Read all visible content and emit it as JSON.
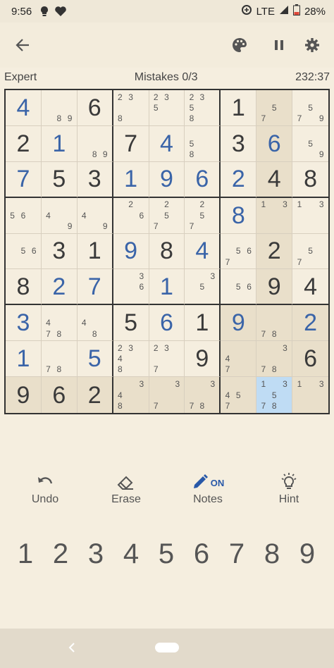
{
  "status": {
    "time": "9:56",
    "network": "LTE",
    "battery": "28%"
  },
  "appbar": {
    "back_icon": "arrow-left-icon",
    "theme_icon": "palette-icon",
    "pause_icon": "pause-icon",
    "settings_icon": "gear-icon"
  },
  "info": {
    "difficulty": "Expert",
    "mistakes": "Mistakes 0/3",
    "timer": "232:37"
  },
  "colors": {
    "accent": "#3a64a8",
    "given": "#3a3a3a",
    "selected": "#bfdcf4",
    "highlight": "#e9dfca",
    "background": "#f5eedf"
  },
  "selected_cell": {
    "row": 9,
    "col": 8
  },
  "grid": [
    [
      {
        "v": "4",
        "t": "user"
      },
      {
        "n": [
          "",
          "",
          "",
          "",
          "",
          "",
          "",
          "8",
          "9"
        ]
      },
      {
        "v": "6",
        "t": "given"
      },
      {
        "n": [
          "2",
          "3",
          "",
          "",
          "",
          "",
          "8",
          "",
          ""
        ]
      },
      {
        "n": [
          "2",
          "3",
          "",
          "5",
          "",
          "",
          "",
          "",
          ""
        ]
      },
      {
        "n": [
          "2",
          "3",
          "",
          "5",
          "",
          "",
          "8",
          "",
          ""
        ]
      },
      {
        "v": "1",
        "t": "given"
      },
      {
        "n": [
          "",
          "",
          "",
          "",
          "5",
          "",
          "7",
          "",
          ""
        ]
      },
      {
        "n": [
          "",
          "",
          "",
          "",
          "5",
          "",
          "7",
          "",
          "9"
        ]
      }
    ],
    [
      {
        "v": "2",
        "t": "given"
      },
      {
        "v": "1",
        "t": "user"
      },
      {
        "n": [
          "",
          "",
          "",
          "",
          "",
          "",
          "",
          "8",
          "9"
        ]
      },
      {
        "v": "7",
        "t": "given"
      },
      {
        "v": "4",
        "t": "user"
      },
      {
        "n": [
          "",
          "",
          "",
          "5",
          "",
          "",
          "8",
          "",
          ""
        ]
      },
      {
        "v": "3",
        "t": "given"
      },
      {
        "v": "6",
        "t": "user"
      },
      {
        "n": [
          "",
          "",
          "",
          "",
          "5",
          "",
          "",
          "",
          "9"
        ]
      }
    ],
    [
      {
        "v": "7",
        "t": "user"
      },
      {
        "v": "5",
        "t": "given"
      },
      {
        "v": "3",
        "t": "given"
      },
      {
        "v": "1",
        "t": "user"
      },
      {
        "v": "9",
        "t": "user"
      },
      {
        "v": "6",
        "t": "user"
      },
      {
        "v": "2",
        "t": "user"
      },
      {
        "v": "4",
        "t": "given"
      },
      {
        "v": "8",
        "t": "given"
      }
    ],
    [
      {
        "n": [
          "",
          "",
          "",
          "5",
          "6",
          "",
          "",
          "",
          ""
        ]
      },
      {
        "n": [
          "",
          "",
          "",
          "4",
          "",
          "",
          "",
          "",
          "9"
        ]
      },
      {
        "n": [
          "",
          "",
          "",
          "4",
          "",
          "",
          "",
          "",
          "9"
        ]
      },
      {
        "n": [
          "",
          "2",
          "",
          "",
          "",
          "6",
          "",
          "",
          ""
        ]
      },
      {
        "n": [
          "",
          "2",
          "",
          "",
          "5",
          "",
          "7",
          "",
          ""
        ]
      },
      {
        "n": [
          "",
          "2",
          "",
          "",
          "5",
          "",
          "7",
          "",
          ""
        ]
      },
      {
        "v": "8",
        "t": "user"
      },
      {
        "n": [
          "1",
          "",
          "3",
          "",
          "",
          "",
          "",
          "",
          ""
        ]
      },
      {
        "n": [
          "1",
          "",
          "3",
          "",
          "",
          "",
          "",
          "",
          ""
        ]
      }
    ],
    [
      {
        "n": [
          "",
          "",
          "",
          "",
          "5",
          "6",
          "",
          "",
          ""
        ]
      },
      {
        "v": "3",
        "t": "given"
      },
      {
        "v": "1",
        "t": "given"
      },
      {
        "v": "9",
        "t": "user"
      },
      {
        "v": "8",
        "t": "given"
      },
      {
        "v": "4",
        "t": "user"
      },
      {
        "n": [
          "",
          "",
          "",
          "",
          "5",
          "6",
          "7",
          "",
          ""
        ]
      },
      {
        "v": "2",
        "t": "given"
      },
      {
        "n": [
          "",
          "",
          "",
          "",
          "5",
          "",
          "7",
          "",
          ""
        ]
      }
    ],
    [
      {
        "v": "8",
        "t": "given"
      },
      {
        "v": "2",
        "t": "user"
      },
      {
        "v": "7",
        "t": "user"
      },
      {
        "n": [
          "",
          "",
          "3",
          "",
          "",
          "6",
          "",
          "",
          ""
        ]
      },
      {
        "v": "1",
        "t": "user"
      },
      {
        "n": [
          "",
          "",
          "3",
          "",
          "5",
          "",
          "",
          "",
          ""
        ]
      },
      {
        "n": [
          "",
          "",
          "",
          "",
          "5",
          "6",
          "",
          "",
          ""
        ]
      },
      {
        "v": "9",
        "t": "given"
      },
      {
        "v": "4",
        "t": "given"
      }
    ],
    [
      {
        "v": "3",
        "t": "user"
      },
      {
        "n": [
          "",
          "",
          "",
          "4",
          "",
          "",
          "7",
          "8",
          ""
        ]
      },
      {
        "n": [
          "",
          "",
          "",
          "4",
          "",
          "",
          "",
          "8",
          ""
        ]
      },
      {
        "v": "5",
        "t": "given"
      },
      {
        "v": "6",
        "t": "user"
      },
      {
        "v": "1",
        "t": "given"
      },
      {
        "v": "9",
        "t": "user"
      },
      {
        "n": [
          "",
          "",
          "",
          "",
          "",
          "",
          "7",
          "8",
          ""
        ]
      },
      {
        "v": "2",
        "t": "user"
      }
    ],
    [
      {
        "v": "1",
        "t": "user"
      },
      {
        "n": [
          "",
          "",
          "",
          "",
          "",
          "",
          "7",
          "8",
          ""
        ]
      },
      {
        "v": "5",
        "t": "user"
      },
      {
        "n": [
          "2",
          "3",
          "",
          "4",
          "",
          "",
          "8",
          "",
          ""
        ]
      },
      {
        "n": [
          "2",
          "3",
          "",
          "",
          "",
          "",
          "7",
          "",
          ""
        ]
      },
      {
        "v": "9",
        "t": "given"
      },
      {
        "n": [
          "",
          "",
          "",
          "4",
          "",
          "",
          "7",
          "",
          ""
        ]
      },
      {
        "n": [
          "",
          "",
          "3",
          "",
          "",
          "",
          "7",
          "8",
          ""
        ]
      },
      {
        "v": "6",
        "t": "given"
      }
    ],
    [
      {
        "v": "9",
        "t": "given"
      },
      {
        "v": "6",
        "t": "given"
      },
      {
        "v": "2",
        "t": "given"
      },
      {
        "n": [
          "",
          "",
          "3",
          "4",
          "",
          "",
          "8",
          "",
          ""
        ]
      },
      {
        "n": [
          "",
          "",
          "3",
          "",
          "",
          "",
          "7",
          "",
          ""
        ]
      },
      {
        "n": [
          "",
          "",
          "3",
          "",
          "",
          "",
          "7",
          "8",
          ""
        ]
      },
      {
        "n": [
          "",
          "",
          "",
          "4",
          "5",
          "",
          "7",
          "",
          ""
        ]
      },
      {
        "n": [
          "1",
          "",
          "3",
          "",
          "5",
          "",
          "7",
          "8",
          ""
        ]
      },
      {
        "n": [
          "1",
          "",
          "3",
          "",
          "",
          "",
          "",
          "",
          ""
        ]
      }
    ]
  ],
  "tools": [
    {
      "name": "undo",
      "label": "Undo",
      "icon": "undo-icon"
    },
    {
      "name": "erase",
      "label": "Erase",
      "icon": "eraser-icon"
    },
    {
      "name": "notes",
      "label": "Notes",
      "icon": "pencil-icon",
      "badge": "ON"
    },
    {
      "name": "hint",
      "label": "Hint",
      "icon": "lightbulb-icon"
    }
  ],
  "numpad": [
    "1",
    "2",
    "3",
    "4",
    "5",
    "6",
    "7",
    "8",
    "9"
  ],
  "navbar": {
    "back_icon": "nav-back-icon",
    "home_icon": "home-pill-icon"
  }
}
